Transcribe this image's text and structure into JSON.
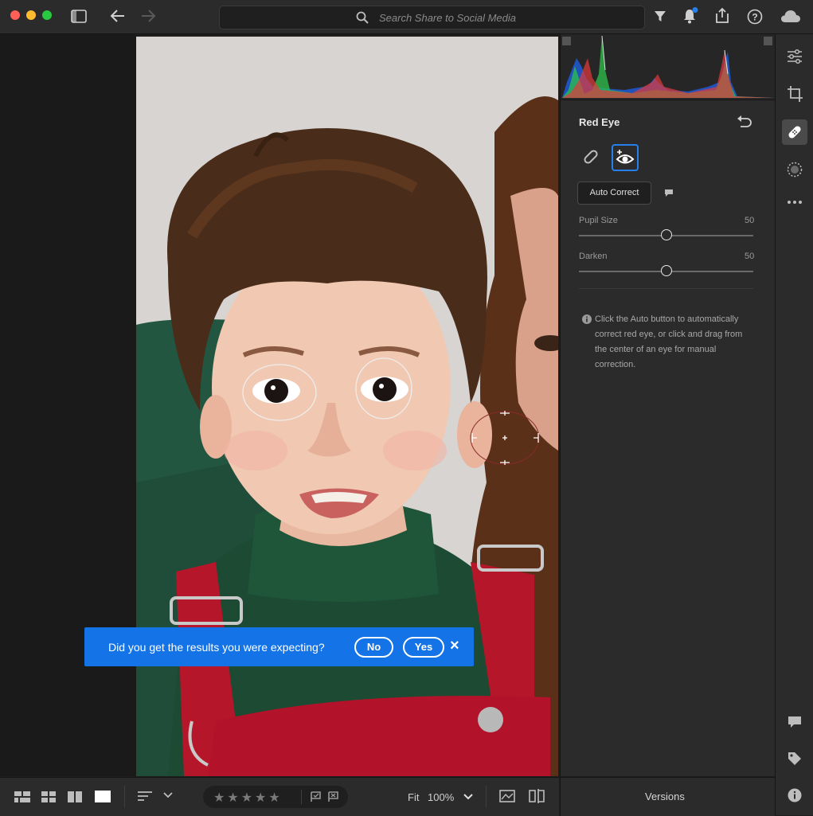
{
  "topbar": {
    "search_placeholder": "Search Share to Social Media",
    "icons": [
      "sidebar-toggle-icon",
      "back-arrow-icon",
      "forward-arrow-icon",
      "search-icon",
      "filter-icon",
      "bell-icon",
      "share-icon",
      "help-icon",
      "cloud-icon"
    ],
    "traffic_lights": {
      "close": "#ff5f57",
      "minimize": "#febc2e",
      "zoom": "#28c840"
    },
    "notification_dot_color": "#2680eb"
  },
  "panel": {
    "section_title": "Red Eye",
    "auto_correct_label": "Auto Correct",
    "sliders": [
      {
        "label": "Pupil Size",
        "value": "50",
        "fraction": 0.5
      },
      {
        "label": "Darken",
        "value": "50",
        "fraction": 0.5
      }
    ],
    "help_text": "Click the Auto button to automatically correct red eye, or click and drag from the center of an eye for manual correction.",
    "selected_tool_color": "#2680eb"
  },
  "histogram": {
    "colors": [
      "#1e5bd6",
      "#2ec24a",
      "#e33b3b",
      "#e0e0e0"
    ]
  },
  "banner": {
    "question": "Did you get the results you were expecting?",
    "no_label": "No",
    "yes_label": "Yes",
    "close_glyph": "×",
    "background": "#1473e6"
  },
  "bottombar": {
    "fit_label": "Fit",
    "zoom_value": "100%",
    "stars": [
      "★",
      "★",
      "★",
      "★",
      "★"
    ]
  },
  "versions_label": "Versions"
}
